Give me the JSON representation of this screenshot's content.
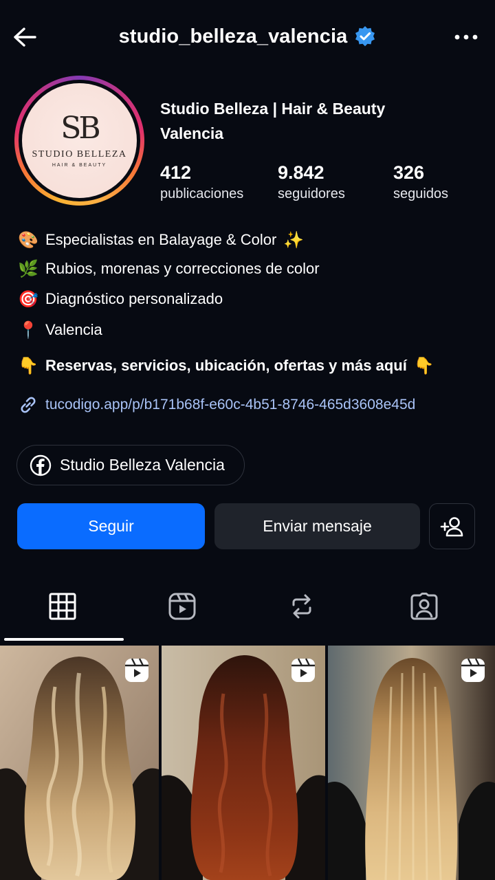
{
  "header": {
    "username": "studio_belleza_valencia"
  },
  "avatar": {
    "monogram": "SB",
    "brand": "STUDIO BELLEZA",
    "tagline": "HAIR & BEAUTY"
  },
  "profile": {
    "name_line1": "Studio Belleza | Hair & Beauty",
    "name_line2": "Valencia"
  },
  "stats": [
    {
      "value": "412",
      "label": "publicaciones"
    },
    {
      "value": "9.842",
      "label": "seguidores"
    },
    {
      "value": "326",
      "label": "seguidos"
    }
  ],
  "bio": {
    "lines": [
      {
        "emoji": "🎨",
        "text": "Especialistas en Balayage & Color",
        "trail": "✨"
      },
      {
        "emoji": "🌿",
        "text": "Rubios, morenas y correcciones de color"
      },
      {
        "emoji": "🎯",
        "text": "Diagnóstico personalizado"
      },
      {
        "emoji": "📍",
        "text": "Valencia"
      }
    ],
    "cta": {
      "emoji": "👇",
      "text": "Reservas, servicios, ubicación, ofertas y más aquí",
      "trail": "👇"
    }
  },
  "link": {
    "url": "tucodigo.app/p/b171b68f-e60c-4b51-8746-465d3608e45d"
  },
  "facebook": {
    "label": "Studio Belleza Valencia"
  },
  "actions": {
    "follow": "Seguir",
    "message": "Enviar mensaje"
  },
  "colors": {
    "background": "#070a12",
    "follow_button": "#0a6cff",
    "secondary_button": "#1f232b",
    "link": "#a9c3f7",
    "verified": "#3897f0"
  },
  "tabs": [
    {
      "icon": "grid-icon",
      "active": true
    },
    {
      "icon": "reels-icon",
      "active": false
    },
    {
      "icon": "reposts-icon",
      "active": false
    },
    {
      "icon": "tagged-icon",
      "active": false
    }
  ],
  "posts": [
    {
      "kind": "reel",
      "hair": "balayage blonde waves"
    },
    {
      "kind": "reel",
      "hair": "auburn copper waves"
    },
    {
      "kind": "reel",
      "hair": "straight golden blonde"
    }
  ]
}
